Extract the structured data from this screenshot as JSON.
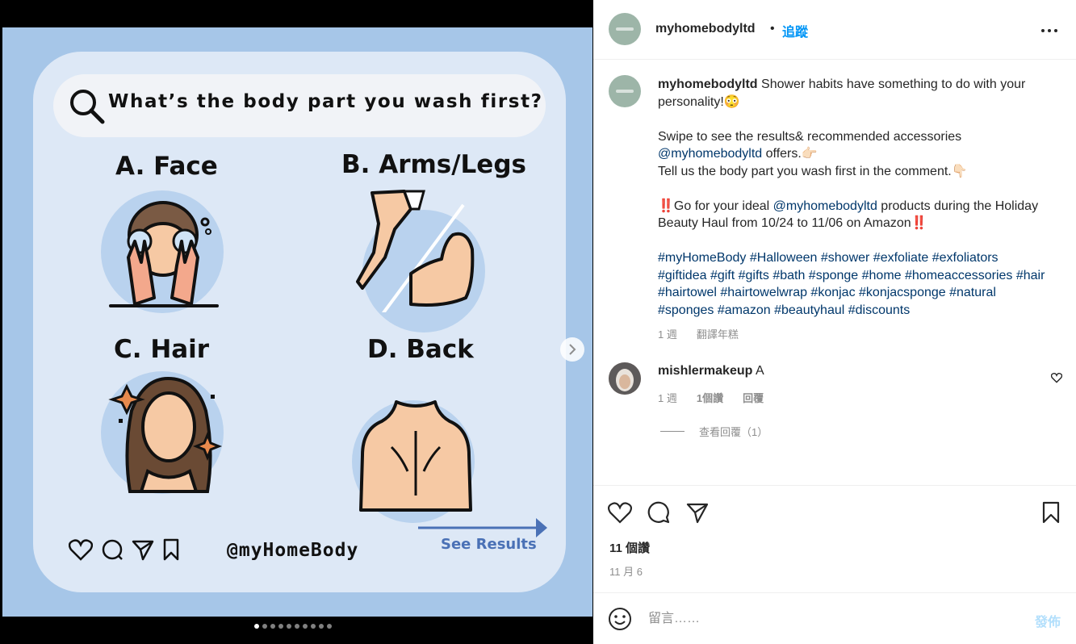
{
  "slide": {
    "question": "What’s the body part you wash first?",
    "options": [
      {
        "label": "A. Face"
      },
      {
        "label": "B. Arms/Legs"
      },
      {
        "label": "C. Hair"
      },
      {
        "label": "D. Back"
      }
    ],
    "handle": "@myHomeBody",
    "see_results": "See Results",
    "total_slides": 10,
    "current_slide": 1
  },
  "header": {
    "username": "myhomebodyltd",
    "separator": "•",
    "follow_label": "追蹤"
  },
  "caption": {
    "username": "myhomebodyltd",
    "line1": "Shower habits have something to do with your personality!😳",
    "line2": "Swipe to see the results& recommended accessories",
    "mention1": "@myhomebodyltd",
    "line3": " offers.👉🏻",
    "line4": "Tell us the body part you wash first in the comment.👇🏻",
    "line5a": "‼️Go for your ideal ",
    "mention2": "@myhomebodyltd",
    "line5b": " products during the Holiday Beauty Haul from 10/24 to 11/06 on Amazon‼️",
    "hashtags": "#myHomeBody #Halloween #shower #exfoliate #exfoliators #giftidea #gift #gifts #bath #sponge #home #homeaccessories #hair #hairtowel #hairtowelwrap #konjac #konjacsponge #natural #sponges #amazon #beautyhaul #discounts",
    "time": "1 週",
    "translate": "翻譯年糕"
  },
  "comment": {
    "username": "mishlermakeup",
    "text": "A",
    "time": "1 週",
    "likes": "1個讚",
    "reply": "回覆",
    "view_replies": "查看回覆（1）"
  },
  "post": {
    "likes": "11 個讚",
    "date": "11 月 6"
  },
  "composer": {
    "placeholder": "留言……",
    "post_label": "發佈"
  },
  "colors": {
    "slide_bg": "#a6c6e8",
    "card_bg": "#dde8f6",
    "link": "#00376b",
    "follow": "#0095f6",
    "see_results": "#4a71b6"
  }
}
